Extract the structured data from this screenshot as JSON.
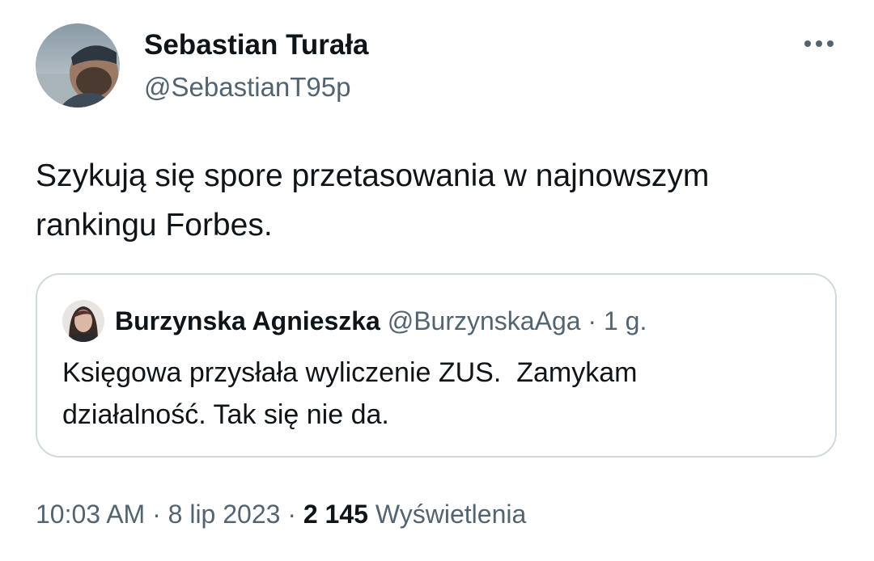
{
  "author": {
    "display_name": "Sebastian Turała",
    "handle": "@SebastianT95p",
    "avatar_icon": "profile-photo-man-with-cap"
  },
  "more_icon": "more-horizontal-icon",
  "tweet": {
    "text": "Szykują się spore przetasowania w najnowszym\nrankingu Forbes."
  },
  "quoted_tweet": {
    "author_name": "Burzynska Agnieszka",
    "handle": "@BurzynskaAga",
    "separator": "·",
    "time": "1 g.",
    "text": "Księgowa przysłała wyliczenie ZUS.  Zamykam\ndziałalność. Tak się nie da.",
    "avatar_icon": "profile-photo-woman"
  },
  "meta": {
    "time": "10:03 AM",
    "separator": "·",
    "date": "8 lip 2023",
    "views_count": "2 145",
    "views_label": "Wyświetlenia"
  },
  "colors": {
    "text_primary": "#0f1419",
    "text_secondary": "#536471",
    "border": "#cfd9de",
    "background": "#ffffff"
  }
}
